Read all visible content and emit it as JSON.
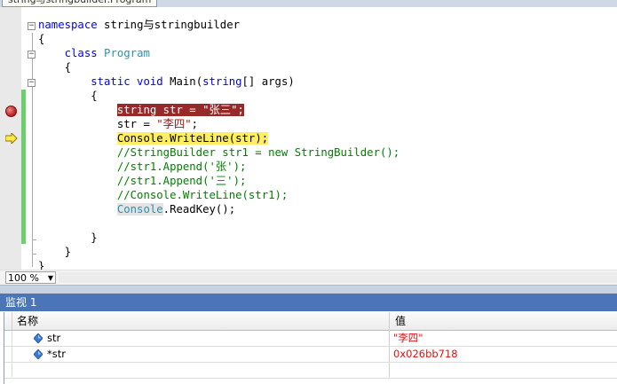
{
  "document_tab": "string与stringbuilder.Program",
  "code_lines": [
    {
      "parts": [
        {
          "t": "namespace ",
          "c": "kw"
        },
        {
          "t": "string与stringbuilder",
          "c": ""
        }
      ]
    },
    {
      "parts": [
        {
          "t": "{",
          "c": ""
        }
      ]
    },
    {
      "parts": [
        {
          "t": "    class ",
          "c": "kw"
        },
        {
          "t": "Program",
          "c": "ty"
        }
      ]
    },
    {
      "parts": [
        {
          "t": "    {",
          "c": ""
        }
      ]
    },
    {
      "parts": [
        {
          "t": "        static void ",
          "c": "kw"
        },
        {
          "t": "Main(",
          "c": ""
        },
        {
          "t": "string",
          "c": "kw"
        },
        {
          "t": "[] args)",
          "c": ""
        }
      ]
    },
    {
      "parts": [
        {
          "t": "        {",
          "c": ""
        }
      ]
    },
    {
      "parts": [
        {
          "t": "            ",
          "c": ""
        },
        {
          "t": "string str = \"张三\";",
          "c": "bpline"
        }
      ]
    },
    {
      "parts": [
        {
          "t": "            str = ",
          "c": ""
        },
        {
          "t": "\"李四\"",
          "c": "st"
        },
        {
          "t": ";",
          "c": ""
        }
      ]
    },
    {
      "parts": [
        {
          "t": "            ",
          "c": ""
        },
        {
          "t": "Console",
          "c": "curline"
        },
        {
          "t": ".WriteLine(str);",
          "c": "curline"
        }
      ]
    },
    {
      "parts": [
        {
          "t": "            //StringBuilder str1 = new StringBuilder();",
          "c": "cm"
        }
      ]
    },
    {
      "parts": [
        {
          "t": "            //str1.Append('张');",
          "c": "cm"
        }
      ]
    },
    {
      "parts": [
        {
          "t": "            //str1.Append('三');",
          "c": "cm"
        }
      ]
    },
    {
      "parts": [
        {
          "t": "            //Console.WriteLine(str1);",
          "c": "cm"
        }
      ]
    },
    {
      "parts": [
        {
          "t": "            ",
          "c": ""
        },
        {
          "t": "Console",
          "c": "tyhl"
        },
        {
          "t": ".ReadKey();",
          "c": ""
        }
      ]
    },
    {
      "parts": [
        {
          "t": "",
          "c": ""
        }
      ]
    },
    {
      "parts": [
        {
          "t": "        }",
          "c": ""
        }
      ]
    },
    {
      "parts": [
        {
          "t": "    }",
          "c": ""
        }
      ]
    },
    {
      "parts": [
        {
          "t": "}",
          "c": ""
        }
      ]
    }
  ],
  "zoom": {
    "value": "100 %"
  },
  "watch": {
    "title": "监视 1",
    "col_name": "名称",
    "col_value": "值",
    "rows": [
      {
        "name": "str",
        "value": "\"李四\""
      },
      {
        "name": "*str",
        "value": "0x026bb718"
      }
    ]
  },
  "colors": {
    "breakpoint_line": "#962a2a",
    "current_line": "#ffee62",
    "keyword": "#0000ff",
    "type": "#2b91af",
    "string": "#a31515",
    "comment": "#008000",
    "watch_title_bg": "#4a76b8",
    "watch_value": "#e01010"
  },
  "icons": {
    "breakpoint": "breakpoint-icon",
    "current_statement": "current-statement-arrow-icon",
    "watch_variable": "watch-variable-icon"
  }
}
